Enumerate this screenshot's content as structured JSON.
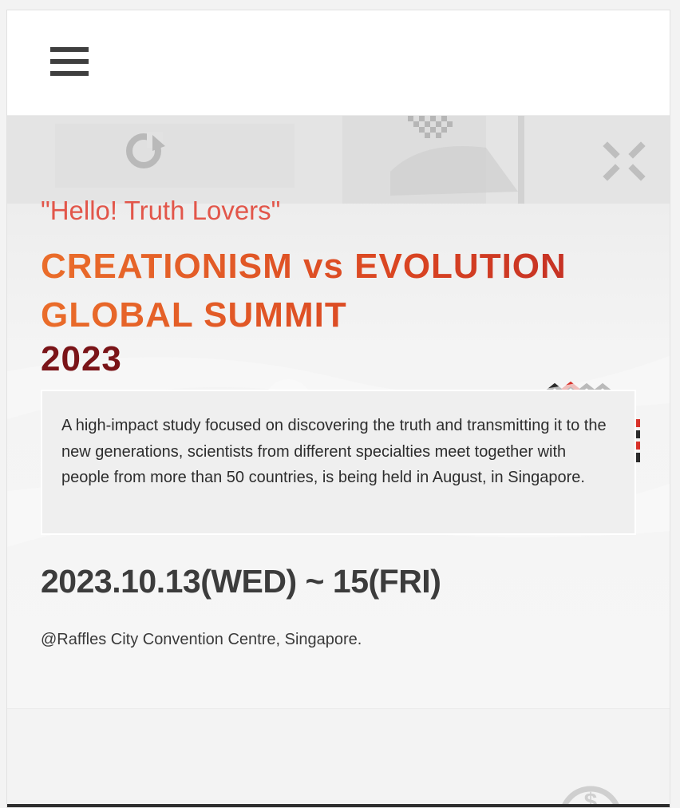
{
  "header": {
    "menu_icon": "hamburger-menu-icon"
  },
  "hero": {
    "greeting": "\"Hello! Truth Lovers\"",
    "title_line1": "CREATIONISM vs EVOLUTION",
    "title_line2": "GLOBAL SUMMIT",
    "title_year": "2023",
    "description": "A high-impact study focused on discovering the truth and transmitting it to the new generations, scientists from different specialties meet together with people from more than 50 countries, is being held in August, in Singapore.",
    "date": "2023.10.13(WED) ~ 15(FRI)",
    "venue": "@Raffles City Convention Centre, Singapore.",
    "background_icons": [
      "refresh-icon",
      "cross-icon",
      "checker-pattern-icon",
      "dollar-icon"
    ]
  },
  "colors": {
    "greeting": "#e2564a",
    "title_gradient_start": "#ea6d2a",
    "title_gradient_end": "#c63224",
    "year": "#7a1418",
    "text_dark": "#3c3c3c"
  }
}
